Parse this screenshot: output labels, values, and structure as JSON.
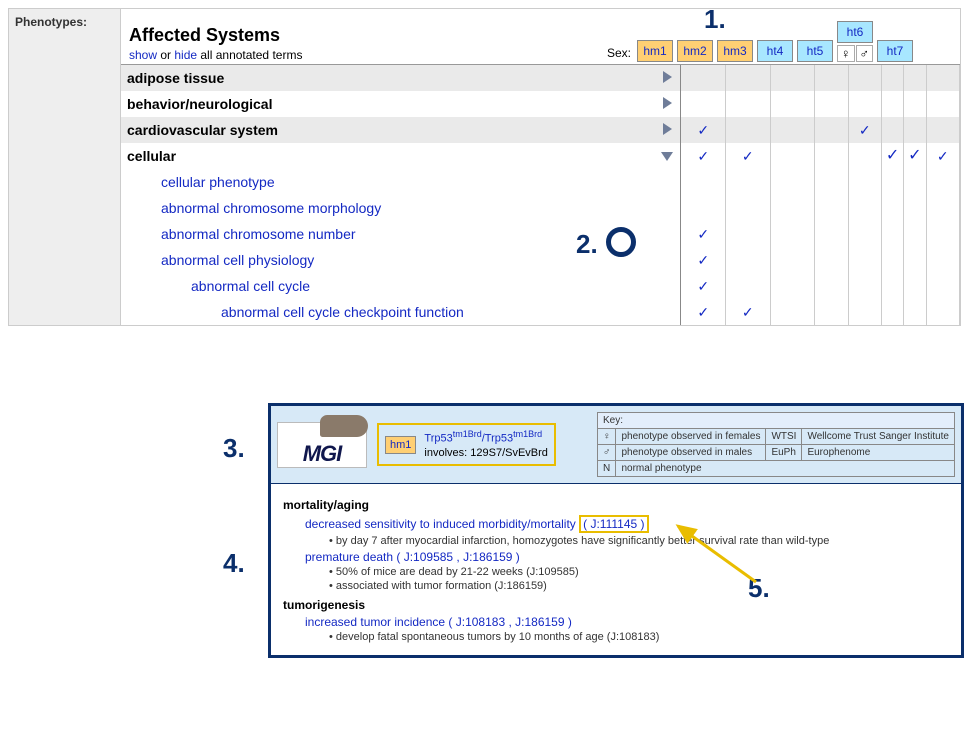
{
  "annotations": {
    "a1": "1.",
    "a2": "2.",
    "a3": "3.",
    "a4": "4.",
    "a5": "5."
  },
  "left": {
    "label": "Phenotypes:"
  },
  "header": {
    "title": "Affected Systems",
    "show": "show",
    "or": " or ",
    "hide": "hide",
    "rest": " all annotated terms",
    "sex": "Sex:"
  },
  "genotypes": [
    {
      "id": "hm1",
      "cls": "hm",
      "split": false
    },
    {
      "id": "hm2",
      "cls": "hm",
      "split": false
    },
    {
      "id": "hm3",
      "cls": "hm",
      "split": false
    },
    {
      "id": "ht4",
      "cls": "ht",
      "split": false
    },
    {
      "id": "ht5",
      "cls": "ht",
      "split": false
    },
    {
      "id": "ht6",
      "cls": "ht",
      "split": true
    },
    {
      "id": "ht7",
      "cls": "ht",
      "split": false
    }
  ],
  "symbols": {
    "female": "♀",
    "male": "♂",
    "check": "✓"
  },
  "rows": [
    {
      "name": "adipose tissue",
      "bold": true,
      "grey": true,
      "toggle": "right",
      "cells": [
        "",
        "",
        "",
        "",
        "",
        "",
        "",
        ""
      ]
    },
    {
      "name": "behavior/neurological",
      "bold": true,
      "grey": false,
      "toggle": "right",
      "cells": [
        "",
        "",
        "",
        "",
        "",
        "",
        "",
        ""
      ]
    },
    {
      "name": "cardiovascular system",
      "bold": true,
      "grey": true,
      "toggle": "right",
      "cells": [
        "✓",
        "",
        "",
        "",
        "✓",
        "",
        "",
        ""
      ]
    },
    {
      "name": "cellular",
      "bold": true,
      "grey": false,
      "toggle": "down",
      "cells": [
        "✓",
        "✓",
        "",
        "",
        "",
        "✓",
        "✓",
        "✓"
      ]
    },
    {
      "name": "cellular phenotype",
      "link": true,
      "indent": 1,
      "grey": false,
      "cells": [
        "",
        "",
        "",
        "",
        "",
        "",
        "",
        ""
      ]
    },
    {
      "name": "abnormal chromosome morphology",
      "link": true,
      "indent": 1,
      "grey": false,
      "cells": [
        "",
        "",
        "",
        "",
        "",
        "",
        "",
        ""
      ]
    },
    {
      "name": "abnormal chromosome number",
      "link": true,
      "indent": 1,
      "grey": false,
      "cells": [
        "✓",
        "",
        "",
        "",
        "",
        "",
        "",
        ""
      ]
    },
    {
      "name": "abnormal cell physiology",
      "link": true,
      "indent": 1,
      "grey": false,
      "cells": [
        "✓",
        "",
        "",
        "",
        "",
        "",
        "",
        ""
      ]
    },
    {
      "name": "abnormal cell cycle",
      "link": true,
      "indent": 2,
      "grey": false,
      "cells": [
        "✓",
        "",
        "",
        "",
        "",
        "",
        "",
        ""
      ]
    },
    {
      "name": "abnormal cell cycle checkpoint function",
      "link": true,
      "indent": 3,
      "grey": false,
      "cells": [
        "✓",
        "✓",
        "",
        "",
        "",
        "",
        "",
        ""
      ]
    }
  ],
  "popup": {
    "logo": "MGI",
    "chip": "hm1",
    "allele_html": "Trp53<sup>tm1Brd</sup>/Trp53<sup>tm1Brd</sup>",
    "involves": "involves: 129S7/SvEvBrd",
    "key": {
      "title": "Key:",
      "rows": [
        [
          "♀",
          "phenotype observed in females",
          "WTSI",
          "Wellcome Trust Sanger Institute"
        ],
        [
          "♂",
          "phenotype observed in males",
          "EuPh",
          "Europhenome"
        ],
        [
          "N",
          "normal phenotype",
          "",
          ""
        ]
      ]
    },
    "sections": [
      {
        "title": "mortality/aging",
        "terms": [
          {
            "label": "decreased sensitivity to induced morbidity/mortality",
            "jref": "( J:111145 )",
            "boxed": true,
            "notes": [
              "• by day 7 after myocardial infarction, homozygotes have significantly better survival rate than wild-type"
            ]
          },
          {
            "label": "premature death",
            "jref": "( J:109585 , J:186159 )",
            "boxed": false,
            "notes": [
              "• 50% of mice are dead by 21-22 weeks (J:109585)",
              "• associated with tumor formation (J:186159)"
            ]
          }
        ]
      },
      {
        "title": "tumorigenesis",
        "terms": [
          {
            "label": "increased tumor incidence",
            "jref": "( J:108183 , J:186159 )",
            "boxed": false,
            "notes": [
              "• develop fatal spontaneous tumors by 10 months of age (J:108183)"
            ]
          }
        ]
      }
    ]
  }
}
